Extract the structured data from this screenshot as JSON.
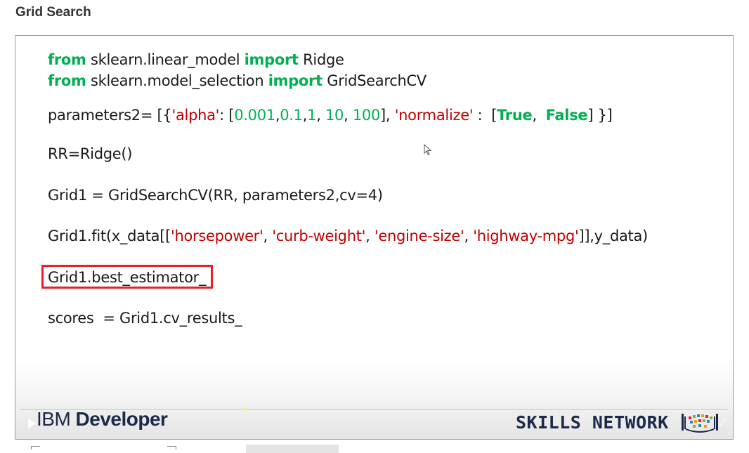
{
  "page": {
    "heading": "Grid Search"
  },
  "code": {
    "line1": {
      "kw1": "from",
      "mod": " sklearn.linear_model ",
      "kw2": "import",
      "name": " Ridge"
    },
    "line2": {
      "kw1": "from",
      "mod": " sklearn.model_selection ",
      "kw2": "import",
      "name": " GridSearchCV"
    },
    "line3": {
      "pre": "parameters2= [{",
      "s_alpha": "'alpha'",
      "sep1": ": [",
      "n1": "0.001",
      "c1": ",",
      "n2": "0.1",
      "c2": ",",
      "n3": "1",
      "c3": ", ",
      "n4": "10",
      "c4": ", ",
      "n5": "100",
      "sep2": "], ",
      "s_norm": "'normalize'",
      "sep3": " :  [",
      "k_true": "True",
      "sep4": ",  ",
      "k_false": "False",
      "end": "] }]"
    },
    "line4": "RR=Ridge()",
    "line5": "Grid1 = GridSearchCV(RR, parameters2,cv=4)",
    "line6": {
      "pre": "Grid1.fit(x_data[[",
      "s1": "'horsepower'",
      "c1": ", ",
      "s2": "'curb-weight'",
      "c2": ", ",
      "s3": "'engine-size'",
      "c3": ", ",
      "s4": "'highway-mpg'",
      "end": "]],y_data)"
    },
    "line7": "Grid1.best_estimator_",
    "line8": "scores  = Grid1.cv_results_"
  },
  "branding": {
    "ibm": "IBM",
    "developer": " Developer",
    "skills_network": "SKILLS NETWORK"
  },
  "colors": {
    "keyword": "#00b050",
    "string": "#c00000",
    "highlight_border": "#e8202a",
    "logo_text": "#1b2a4a"
  },
  "icons": {
    "cursor": "mouse-pointer-icon",
    "play": "play-icon",
    "fullscreen": "fullscreen-icon",
    "skills_logo": "skills-network-logo-icon"
  }
}
